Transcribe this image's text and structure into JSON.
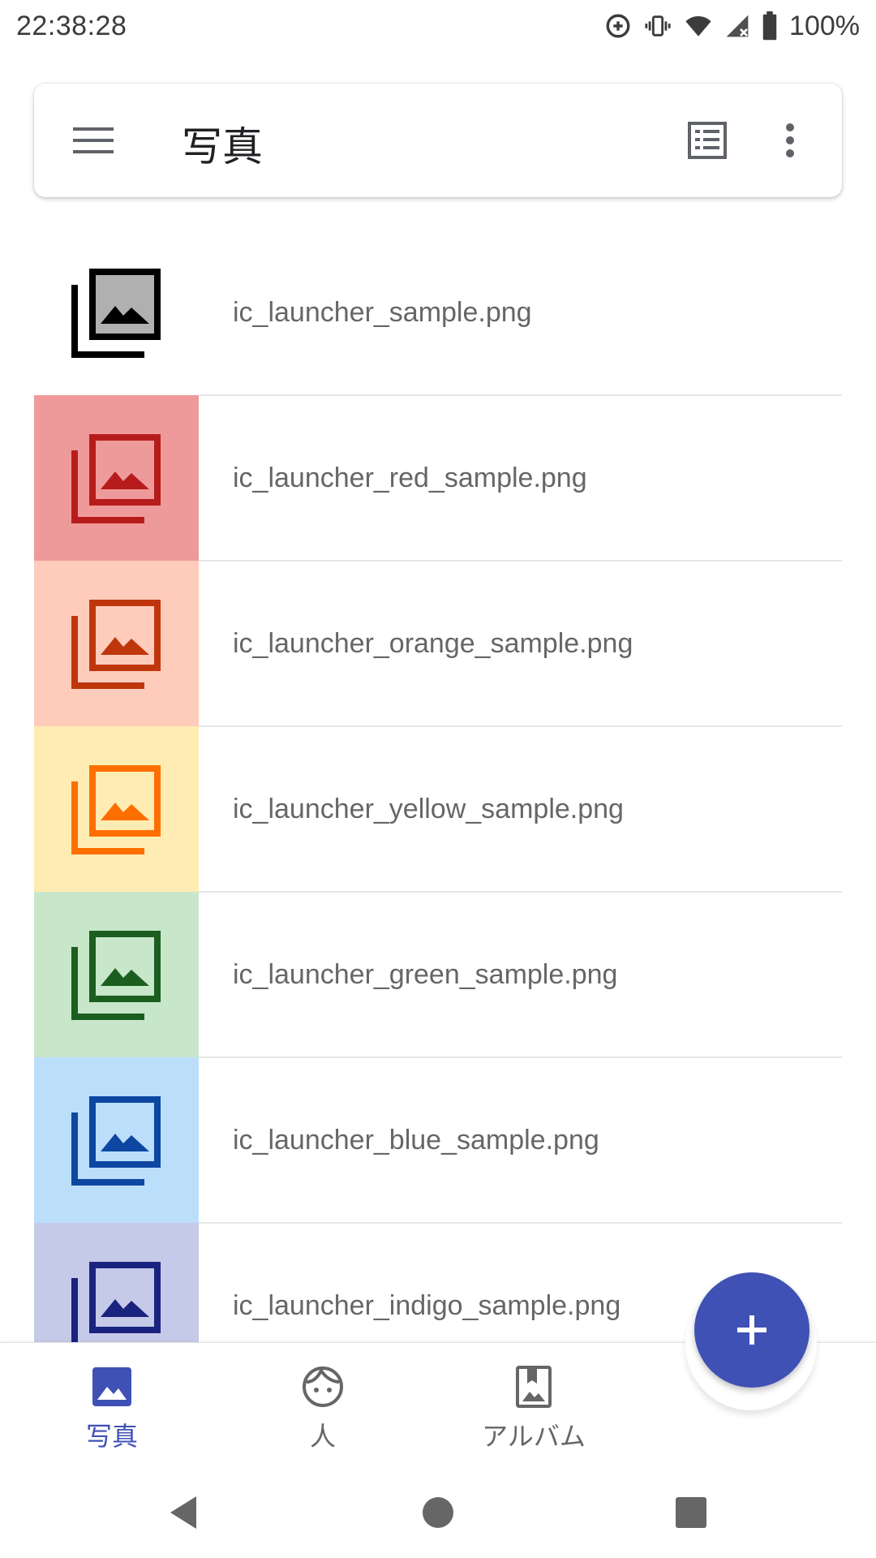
{
  "status_bar": {
    "time": "22:38:28",
    "battery": "100%",
    "icons": [
      "data-saver-icon",
      "vibrate-icon",
      "wifi-icon",
      "signal-icon",
      "battery-icon"
    ]
  },
  "app_bar": {
    "title": "写真",
    "menu_icon": "menu-icon",
    "view_icon": "list-view-icon",
    "overflow_icon": "more-vert-icon"
  },
  "files": [
    {
      "name": "ic_launcher_sample.png",
      "bg": "#ffffff",
      "fg": "#000000",
      "fill": "#b0b0b0"
    },
    {
      "name": "ic_launcher_red_sample.png",
      "bg": "#ef9a9a",
      "fg": "#b71c1c",
      "fill": "#ef9a9a"
    },
    {
      "name": "ic_launcher_orange_sample.png",
      "bg": "#ffccbc",
      "fg": "#bf360c",
      "fill": "#ffccbc"
    },
    {
      "name": "ic_launcher_yellow_sample.png",
      "bg": "#ffecb3",
      "fg": "#ff6f00",
      "fill": "#ffecb3"
    },
    {
      "name": "ic_launcher_green_sample.png",
      "bg": "#c8e6c9",
      "fg": "#1b5e20",
      "fill": "#c8e6c9"
    },
    {
      "name": "ic_launcher_blue_sample.png",
      "bg": "#bbdefb",
      "fg": "#0d47a1",
      "fill": "#bbdefb"
    },
    {
      "name": "ic_launcher_indigo_sample.png",
      "bg": "#c5cae9",
      "fg": "#1a237e",
      "fill": "#c5cae9"
    }
  ],
  "fab": {
    "icon": "plus-icon",
    "color": "#3f51b5"
  },
  "bottom_nav": {
    "items": [
      {
        "label": "写真",
        "icon": "photo-icon",
        "active": true
      },
      {
        "label": "人",
        "icon": "face-icon",
        "active": false
      },
      {
        "label": "アルバム",
        "icon": "album-icon",
        "active": false
      }
    ],
    "active_color": "#3f51b5",
    "inactive_color": "#666666"
  },
  "system_nav": {
    "icons": [
      "back-icon",
      "home-icon",
      "recents-icon"
    ]
  }
}
